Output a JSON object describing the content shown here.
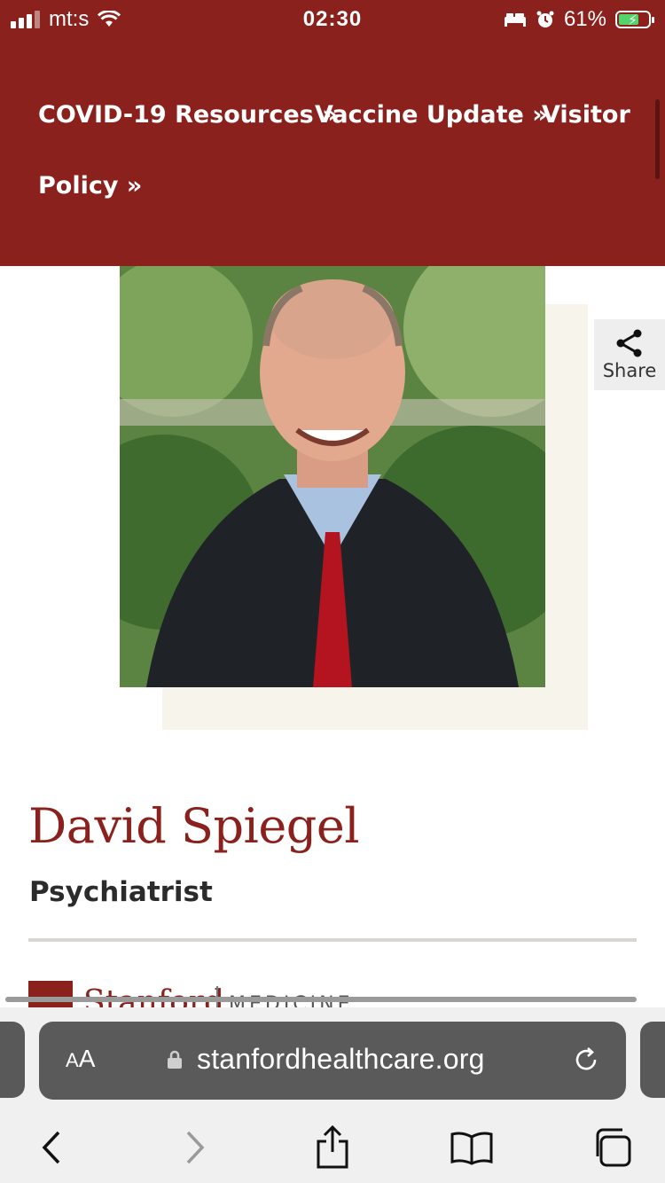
{
  "status_bar": {
    "carrier": "mt:s",
    "time": "02:30",
    "battery_percent": "61%",
    "battery_level": 0.61,
    "icons": [
      "signal-icon",
      "wifi-icon",
      "bed-icon",
      "alarm-icon",
      "battery-charging-icon"
    ]
  },
  "nav": {
    "links": [
      {
        "label": "COVID-19 Resources »"
      },
      {
        "label": "Vaccine Update »"
      },
      {
        "label": "Visitor"
      },
      {
        "label": "Policy »"
      }
    ]
  },
  "share": {
    "label": "Share",
    "icon": "share-icon"
  },
  "profile": {
    "name": "David Spiegel",
    "title": "Psychiatrist"
  },
  "logo": {
    "brand": "Stanford",
    "sub": "MEDICINE"
  },
  "browser": {
    "aa_label_small": "A",
    "aa_label_large": "A",
    "url": "stanfordhealthcare.org",
    "icons": [
      "lock-icon",
      "reload-icon",
      "back-icon",
      "forward-icon",
      "share-icon",
      "bookmarks-icon",
      "tabs-icon"
    ]
  },
  "colors": {
    "brand": "#8a211d",
    "photo_backdrop": "#f7f4ec",
    "address_bar": "#5a5a5a"
  }
}
